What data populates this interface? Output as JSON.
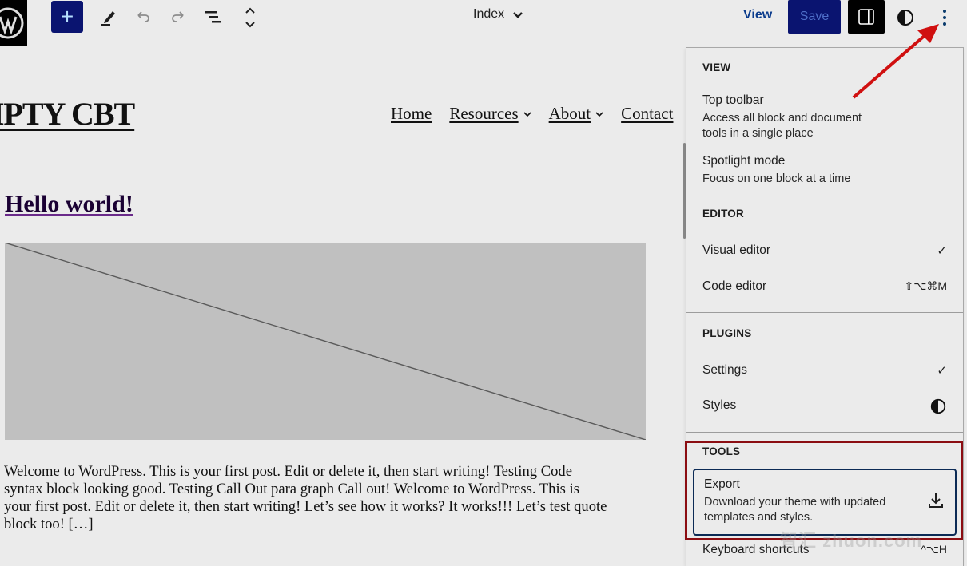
{
  "topbar": {
    "logo_icon": "wordpress-logo-icon",
    "add_block_label": "+",
    "tool_icons": [
      "pencil-icon",
      "undo-icon",
      "redo-icon",
      "list-view-icon",
      "chevron-up-down-icon"
    ],
    "document_title": "Index",
    "view_label": "View",
    "save_label": "Save",
    "settings_icon": "sidebar-toggle-icon",
    "styles_icon": "half-circle-icon",
    "more_icon": "vertical-ellipsis-icon"
  },
  "canvas": {
    "site_title": "EMPTY CBT",
    "nav": [
      {
        "label": "Home",
        "has_submenu": false
      },
      {
        "label": "Resources",
        "has_submenu": true
      },
      {
        "label": "About",
        "has_submenu": true
      },
      {
        "label": "Contact",
        "has_submenu": false
      }
    ],
    "nav_chevron": "⌄",
    "post_title": "Hello world!",
    "excerpt_lines": [
      "Welcome to WordPress. This is your first post. Edit or delete it, then start writing! Testing Code",
      "syntax block looking good. Testing Call Out para graph Call out! Welcome to WordPress. This is",
      "your first post. Edit or delete it, then start writing! Let’s see how it works? It works!!! Let’s test quote",
      "block too! […]"
    ]
  },
  "menu": {
    "groups": {
      "view": {
        "label": "VIEW",
        "items": [
          {
            "title": "Top toolbar",
            "description_lines": [
              "Access all block and document",
              "tools in a single place"
            ]
          },
          {
            "title": "Spotlight mode",
            "description_lines": [
              "Focus on one block at a time"
            ]
          }
        ]
      },
      "editor": {
        "label": "EDITOR",
        "items": [
          {
            "title": "Visual editor",
            "suffix": "✓"
          },
          {
            "title": "Code editor",
            "suffix": "⇧⌥⌘M"
          }
        ]
      },
      "plugins": {
        "label": "PLUGINS",
        "items": [
          {
            "title": "Settings",
            "suffix": "✓"
          },
          {
            "title": "Styles",
            "suffix_icon": "half-circle-icon"
          }
        ]
      },
      "tools": {
        "label": "TOOLS",
        "items": [
          {
            "title": "Export",
            "description_lines": [
              "Download your theme with updated",
              "templates and styles."
            ],
            "suffix_icon": "download-icon"
          },
          {
            "title": "Keyboard shortcuts",
            "suffix": "^⌥H"
          }
        ]
      }
    }
  },
  "annotations": {
    "arrow_color": "#d01010",
    "highlight_color": "#8b0d12"
  },
  "watermark": "智汇 zhuon.com"
}
